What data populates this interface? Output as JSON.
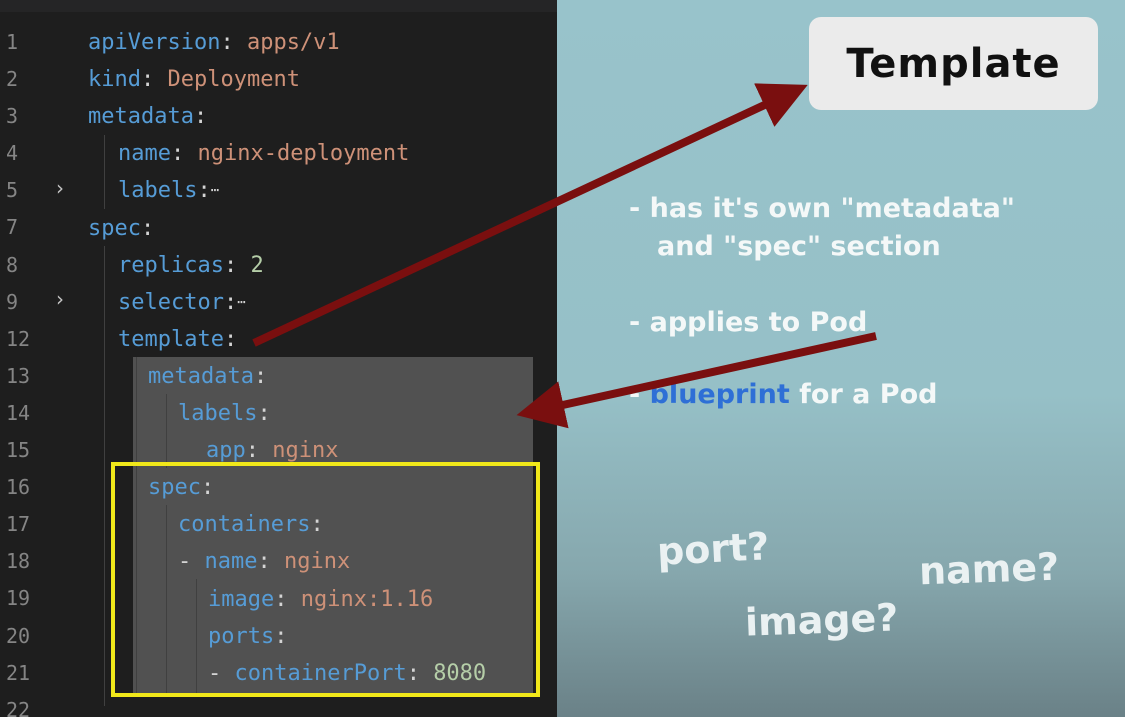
{
  "editor": {
    "line_numbers": [
      "1",
      "2",
      "3",
      "4",
      "5",
      "7",
      "8",
      "9",
      "12",
      "13",
      "14",
      "15",
      "16",
      "17",
      "18",
      "19",
      "20",
      "21",
      "22"
    ],
    "lines": [
      {
        "tokens": [
          {
            "t": "apiVersion",
            "c": "k"
          },
          {
            "t": ": ",
            "c": "p"
          },
          {
            "t": "apps/v1",
            "c": "s"
          }
        ]
      },
      {
        "tokens": [
          {
            "t": "kind",
            "c": "k"
          },
          {
            "t": ": ",
            "c": "p"
          },
          {
            "t": "Deployment",
            "c": "s"
          }
        ]
      },
      {
        "tokens": [
          {
            "t": "metadata",
            "c": "k"
          },
          {
            "t": ":",
            "c": "p"
          }
        ]
      },
      {
        "tokens": [
          {
            "t": "name",
            "c": "k"
          },
          {
            "t": ": ",
            "c": "p"
          },
          {
            "t": "nginx-deployment",
            "c": "s"
          }
        ]
      },
      {
        "tokens": [
          {
            "t": "labels",
            "c": "k"
          },
          {
            "t": ":",
            "c": "p"
          },
          {
            "t": "⋯",
            "c": "ell"
          }
        ]
      },
      {
        "tokens": [
          {
            "t": "spec",
            "c": "k"
          },
          {
            "t": ":",
            "c": "p"
          }
        ]
      },
      {
        "tokens": [
          {
            "t": "replicas",
            "c": "k"
          },
          {
            "t": ": ",
            "c": "p"
          },
          {
            "t": "2",
            "c": "n"
          }
        ]
      },
      {
        "tokens": [
          {
            "t": "selector",
            "c": "k"
          },
          {
            "t": ":",
            "c": "p"
          },
          {
            "t": "⋯",
            "c": "ell"
          }
        ]
      },
      {
        "tokens": [
          {
            "t": "template",
            "c": "k"
          },
          {
            "t": ":",
            "c": "p"
          }
        ]
      },
      {
        "tokens": [
          {
            "t": "metadata",
            "c": "k"
          },
          {
            "t": ":",
            "c": "p"
          }
        ]
      },
      {
        "tokens": [
          {
            "t": "labels",
            "c": "k"
          },
          {
            "t": ":",
            "c": "p"
          }
        ]
      },
      {
        "tokens": [
          {
            "t": "app",
            "c": "k"
          },
          {
            "t": ": ",
            "c": "p"
          },
          {
            "t": "nginx",
            "c": "s"
          }
        ]
      },
      {
        "tokens": [
          {
            "t": "spec",
            "c": "k"
          },
          {
            "t": ":",
            "c": "p"
          }
        ]
      },
      {
        "tokens": [
          {
            "t": "containers",
            "c": "k"
          },
          {
            "t": ":",
            "c": "p"
          }
        ]
      },
      {
        "tokens": [
          {
            "t": "- ",
            "c": "p"
          },
          {
            "t": "name",
            "c": "k"
          },
          {
            "t": ": ",
            "c": "p"
          },
          {
            "t": "nginx",
            "c": "s"
          }
        ]
      },
      {
        "tokens": [
          {
            "t": "image",
            "c": "k"
          },
          {
            "t": ": ",
            "c": "p"
          },
          {
            "t": "nginx:1.16",
            "c": "s"
          }
        ]
      },
      {
        "tokens": [
          {
            "t": "ports",
            "c": "k"
          },
          {
            "t": ":",
            "c": "p"
          }
        ]
      },
      {
        "tokens": [
          {
            "t": "- ",
            "c": "p"
          },
          {
            "t": "containerPort",
            "c": "k"
          },
          {
            "t": ": ",
            "c": "p"
          },
          {
            "t": "8080",
            "c": "n"
          }
        ]
      },
      {
        "tokens": []
      }
    ],
    "fold_markers": [
      "›",
      "›"
    ]
  },
  "slide": {
    "label": "Template",
    "bullets": {
      "b1_line1": "- has it's own \"metadata\"",
      "b1_line2": "and \"spec\" section",
      "b2": "- applies to Pod",
      "b3_prefix": "- ",
      "b3_highlight": "blueprint",
      "b3_rest": " for a Pod"
    },
    "questions": {
      "port": "port?",
      "name": "name?",
      "image": "image?"
    }
  },
  "colors": {
    "editor_bg": "#1e1e1e",
    "key": "#569cd6",
    "string": "#ce9178",
    "number": "#b5cea8",
    "highlight_box": "#f1e81a",
    "arrow": "#7a0f0f",
    "slide_bg": "#98c3cb",
    "blueprint": "#2e6fd6"
  }
}
